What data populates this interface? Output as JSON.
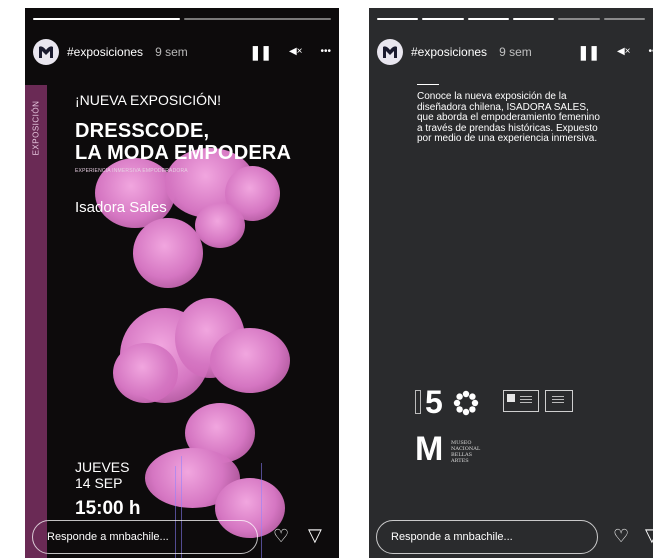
{
  "stories": [
    {
      "username": "#exposiciones",
      "time": "9 sem",
      "vertical_label": "EXPOSICIÓN",
      "kicker": "¡NUEVA EXPOSICIÓN!",
      "headline_line1": "DRESSCODE,",
      "headline_line2": "LA MODA EMPODERA",
      "tagline": "EXPERIENCIA INMERSIVA EMPODERADORA",
      "artist": "Isadora Sales",
      "day": "JUEVES",
      "date": "14 SEP",
      "time_of_event": "15:00 h",
      "reply_placeholder": "Responde a mnbachile...",
      "progress_segments": 2
    },
    {
      "username": "#exposiciones",
      "time": "9 sem",
      "description": "Conoce la nueva exposición de la diseñadora chilena, ISADORA SALES, que aborda el empoderamiento femenino a través de prendas históricas. Expuesto por medio de una experiencia inmersiva.",
      "logo_number": "5",
      "logo_letter": "M",
      "museum_line1": "MUSEO",
      "museum_line2": "NACIONAL",
      "museum_line3": "BELLAS",
      "museum_line4": "ARTES",
      "reply_placeholder": "Responde a mnbachile...",
      "progress_segments": 6
    }
  ],
  "icons": {
    "pause": "❚❚",
    "mute": "◀×",
    "more": "•••",
    "heart": "♡",
    "send": "▽"
  },
  "colors": {
    "story_bg": "#0d0b0c",
    "story2_bg": "#2a2b2d",
    "band": "#6a2a55",
    "blob": "#e089cf"
  }
}
